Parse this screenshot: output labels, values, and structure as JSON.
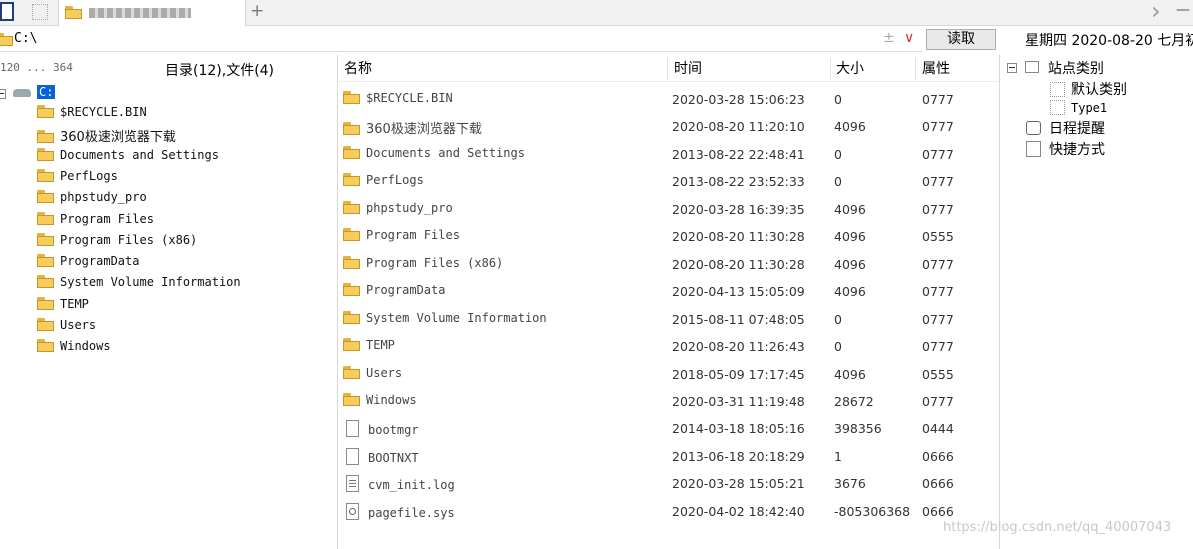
{
  "tabs": {
    "active_tab_title": "",
    "add_tab_glyph": "+",
    "back_glyph": "›",
    "min_glyph": "—"
  },
  "address": {
    "path": "C:\\",
    "plus_glyph": "±",
    "dropdown_glyph": "∨",
    "read_label": "读取",
    "date_text": "星期四 2020-08-20 七月初"
  },
  "left": {
    "drive_info": "120 ... 364",
    "summary": "目录(12),文件(4)",
    "root_label": "C:",
    "tree": [
      "$RECYCLE.BIN",
      "360极速浏览器下载",
      "Documents and Settings",
      "PerfLogs",
      "phpstudy_pro",
      "Program Files",
      "Program Files (x86)",
      "ProgramData",
      "System Volume Information",
      "TEMP",
      "Users",
      "Windows"
    ]
  },
  "columns": {
    "name": "名称",
    "time": "时间",
    "size": "大小",
    "attr": "属性"
  },
  "files": [
    {
      "name": "$RECYCLE.BIN",
      "time": "2020-03-28 15:06:23",
      "size": "0",
      "attr": "0777",
      "icon": "folder"
    },
    {
      "name": "360极速浏览器下载",
      "time": "2020-08-20 11:20:10",
      "size": "4096",
      "attr": "0777",
      "icon": "folder"
    },
    {
      "name": "Documents and Settings",
      "time": "2013-08-22 22:48:41",
      "size": "0",
      "attr": "0777",
      "icon": "folder"
    },
    {
      "name": "PerfLogs",
      "time": "2013-08-22 23:52:33",
      "size": "0",
      "attr": "0777",
      "icon": "folder"
    },
    {
      "name": "phpstudy_pro",
      "time": "2020-03-28 16:39:35",
      "size": "4096",
      "attr": "0777",
      "icon": "folder"
    },
    {
      "name": "Program Files",
      "time": "2020-08-20 11:30:28",
      "size": "4096",
      "attr": "0555",
      "icon": "folder"
    },
    {
      "name": "Program Files (x86)",
      "time": "2020-08-20 11:30:28",
      "size": "4096",
      "attr": "0777",
      "icon": "folder"
    },
    {
      "name": "ProgramData",
      "time": "2020-04-13 15:05:09",
      "size": "4096",
      "attr": "0777",
      "icon": "folder"
    },
    {
      "name": "System Volume Information",
      "time": "2015-08-11 07:48:05",
      "size": "0",
      "attr": "0777",
      "icon": "folder"
    },
    {
      "name": "TEMP",
      "time": "2020-08-20 11:26:43",
      "size": "0",
      "attr": "0777",
      "icon": "folder"
    },
    {
      "name": "Users",
      "time": "2018-05-09 17:17:45",
      "size": "4096",
      "attr": "0555",
      "icon": "folder"
    },
    {
      "name": "Windows",
      "time": "2020-03-31 11:19:48",
      "size": "28672",
      "attr": "0777",
      "icon": "folder"
    },
    {
      "name": "bootmgr",
      "time": "2014-03-18 18:05:16",
      "size": "398356",
      "attr": "0444",
      "icon": "file"
    },
    {
      "name": "BOOTNXT",
      "time": "2013-06-18 20:18:29",
      "size": "1",
      "attr": "0666",
      "icon": "file"
    },
    {
      "name": "cvm_init.log",
      "time": "2020-03-28 15:05:21",
      "size": "3676",
      "attr": "0666",
      "icon": "file-lines"
    },
    {
      "name": "pagefile.sys",
      "time": "2020-04-02 18:42:40",
      "size": "-805306368",
      "attr": "0666",
      "icon": "file-gear"
    }
  ],
  "side": {
    "site_category": "站点类别",
    "default_category": "默认类别",
    "type1": "Type1",
    "schedule": "日程提醒",
    "shortcuts": "快捷方式"
  },
  "watermark": "https://blog.csdn.net/qq_40007043"
}
